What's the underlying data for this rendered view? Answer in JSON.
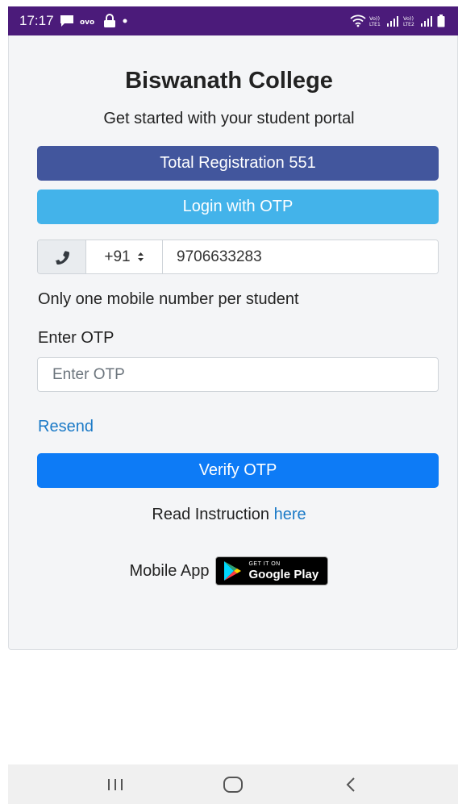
{
  "status_bar": {
    "time": "17:17",
    "left_icons": [
      "message-icon",
      "ovo-icon",
      "lock-icon",
      "dot-icon"
    ],
    "right_icons": [
      "wifi-icon",
      "volte1-signal-icon",
      "volte2-signal-icon",
      "battery-icon"
    ],
    "sim1_label": "Vo)) LTE1",
    "sim2_label": "Vo)) LTE2"
  },
  "portal": {
    "title": "Biswanath College",
    "subtitle": "Get started with your student portal",
    "registration_label": "Total Registration 551",
    "login_label": "Login with OTP",
    "phone_icon": "phone-icon",
    "country_code": "+91",
    "mobile_number": "9706633283",
    "mobile_note": "Only one mobile number per student",
    "otp_label": "Enter OTP",
    "otp_placeholder": "Enter OTP",
    "resend_label": "Resend",
    "verify_label": "Verify OTP",
    "instruction_text": "Read Instruction",
    "instruction_link": "here",
    "mobile_app_label": "Mobile App",
    "play_badge_small": "GET IT ON",
    "play_badge_big": "Google Play"
  },
  "nav_bar": {
    "items": [
      "recent-apps-icon",
      "home-icon",
      "back-icon"
    ]
  },
  "colors": {
    "status_bar": "#4b1b7a",
    "registration_button": "#42569d",
    "login_button": "#43b3ea",
    "verify_button": "#0d7bf6",
    "link": "#1b7ac7"
  }
}
